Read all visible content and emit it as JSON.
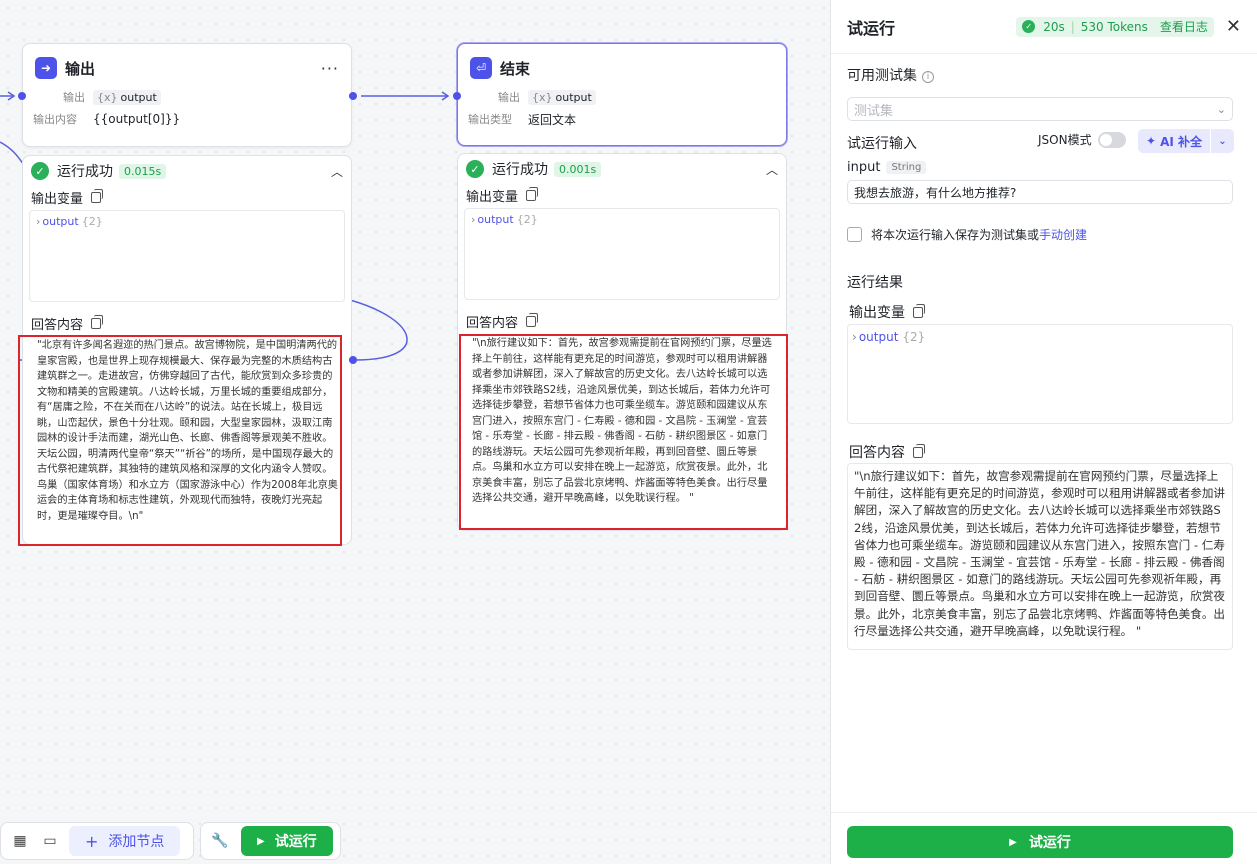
{
  "output_node": {
    "title": "输出",
    "more": "···",
    "out_label": "输出",
    "out_var": "output",
    "content_label": "输出内容",
    "content_value": "{{output[0]}}"
  },
  "end_node": {
    "title": "结束",
    "out_label": "输出",
    "out_var": "output",
    "type_label": "输出类型",
    "type_value": "返回文本"
  },
  "output_result": {
    "status": "运行成功",
    "time": "0.015s",
    "vars_label": "输出变量",
    "var_name": "output",
    "var_count": "{2}",
    "answer_label": "回答内容",
    "answer": "\"北京有许多闻名遐迩的热门景点。故宫博物院，是中国明清两代的皇家宫殿，也是世界上现存规模最大、保存最为完整的木质结构古建筑群之一。走进故宫，仿佛穿越回了古代，能欣赏到众多珍贵的文物和精美的宫殿建筑。八达岭长城，万里长城的重要组成部分，有“居庸之险，不在关而在八达岭”的说法。站在长城上，极目远眺，山峦起伏，景色十分壮观。颐和园，大型皇家园林，汲取江南园林的设计手法而建，湖光山色、长廊、佛香阁等景观美不胜收。天坛公园，明清两代皇帝“祭天”“祈谷”的场所，是中国现存最大的古代祭祀建筑群，其独特的建筑风格和深厚的文化内涵令人赞叹。鸟巢（国家体育场）和水立方（国家游泳中心）作为2008年北京奥运会的主体育场和标志性建筑，外观现代而独特，夜晚灯光亮起时，更是璀璨夺目。\\n\""
  },
  "end_result": {
    "status": "运行成功",
    "time": "0.001s",
    "vars_label": "输出变量",
    "var_name": "output",
    "var_count": "{2}",
    "answer_label": "回答内容",
    "answer": "\"\\n旅行建议如下：首先，故宫参观需提前在官网预约门票，尽量选择上午前往，这样能有更充足的时间游览，参观时可以租用讲解器或者参加讲解团，深入了解故宫的历史文化。去八达岭长城可以选择乘坐市郊铁路S2线，沿途风景优美，到达长城后，若体力允许可选择徒步攀登，若想节省体力也可乘坐缆车。游览颐和园建议从东宫门进入，按照东宫门 - 仁寿殿 - 德和园 - 文昌院 - 玉澜堂 - 宜芸馆 - 乐寿堂 - 长廊 - 排云殿 - 佛香阁 - 石舫 - 耕织图景区 - 如意门的路线游玩。天坛公园可先参观祈年殿，再到回音壁、圜丘等景点。鸟巢和水立方可以安排在晚上一起游览，欣赏夜景。此外，北京美食丰富，别忘了品尝北京烤鸭、炸酱面等特色美食。出行尽量选择公共交通，避开早晚高峰，以免耽误行程。 \""
  },
  "toolbar": {
    "add_node": "添加节点",
    "run": "试运行"
  },
  "panel": {
    "title": "试运行",
    "duration": "20s",
    "tokens": "530 Tokens",
    "view_log": "查看日志",
    "testset_label": "可用测试集",
    "testset_placeholder": "测试集",
    "run_input_label": "试运行输入",
    "json_mode": "JSON模式",
    "ai_fill": "AI 补全",
    "input_name": "input",
    "input_type": "String",
    "input_value": "我想去旅游，有什么地方推荐?",
    "save_text": "将本次运行输入保存为测试集或",
    "save_link": "手动创建",
    "results_label": "运行结果",
    "vars_label": "输出变量",
    "var_name": "output",
    "var_count": "{2}",
    "answer_label": "回答内容",
    "answer": "\"\\n旅行建议如下：首先，故宫参观需提前在官网预约门票，尽量选择上午前往，这样能有更充足的时间游览，参观时可以租用讲解器或者参加讲解团，深入了解故宫的历史文化。去八达岭长城可以选择乘坐市郊铁路S2线，沿途风景优美，到达长城后，若体力允许可选择徒步攀登，若想节省体力也可乘坐缆车。游览颐和园建议从东宫门进入，按照东宫门 - 仁寿殿 - 德和园 - 文昌院 - 玉澜堂 - 宜芸馆 - 乐寿堂 - 长廊 - 排云殿 - 佛香阁 - 石舫 - 耕织图景区 - 如意门的路线游玩。天坛公园可先参观祈年殿，再到回音壁、圜丘等景点。鸟巢和水立方可以安排在晚上一起游览，欣赏夜景。此外，北京美食丰富，别忘了品尝北京烤鸭、炸酱面等特色美食。出行尽量选择公共交通，避开早晚高峰，以免耽误行程。 \"",
    "run_button": "试运行"
  },
  "colors": {
    "accent": "#4d53e8",
    "success": "#1db048",
    "highlight": "#d9252b"
  }
}
